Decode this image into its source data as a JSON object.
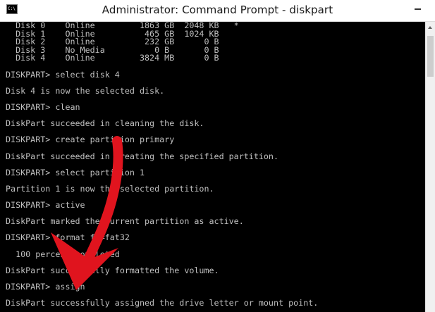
{
  "window": {
    "title": "Administrator: Command Prompt - diskpart",
    "icon": "C:\\"
  },
  "console": {
    "lines": [
      "  Disk 0    Online         1863 GB  2048 KB   *",
      "  Disk 1    Online          465 GB  1024 KB",
      "  Disk 2    Online          232 GB      0 B",
      "  Disk 3    No Media          0 B       0 B",
      "  Disk 4    Online         3824 MB      0 B",
      "",
      "DISKPART> select disk 4",
      "",
      "Disk 4 is now the selected disk.",
      "",
      "DISKPART> clean",
      "",
      "DiskPart succeeded in cleaning the disk.",
      "",
      "DISKPART> create partition primary",
      "",
      "DiskPart succeeded in creating the specified partition.",
      "",
      "DISKPART> select partition 1",
      "",
      "Partition 1 is now the selected partition.",
      "",
      "DISKPART> active",
      "",
      "DiskPart marked the current partition as active.",
      "",
      "DISKPART> format fs=fat32",
      "",
      "  100 percent completed",
      "",
      "DiskPart successfully formatted the volume.",
      "",
      "DISKPART> assign",
      "",
      "DiskPart successfully assigned the drive letter or mount point.",
      ""
    ]
  },
  "colors": {
    "console_bg": "#000000",
    "console_fg": "#c0c0c0",
    "titlebar_bg": "#ffffff",
    "annotation_arrow": "#e0141e"
  },
  "icons": {
    "window_icon": "cmd-icon",
    "minimize": "minimize-icon",
    "scroll_up": "scroll-up-arrow-icon"
  }
}
